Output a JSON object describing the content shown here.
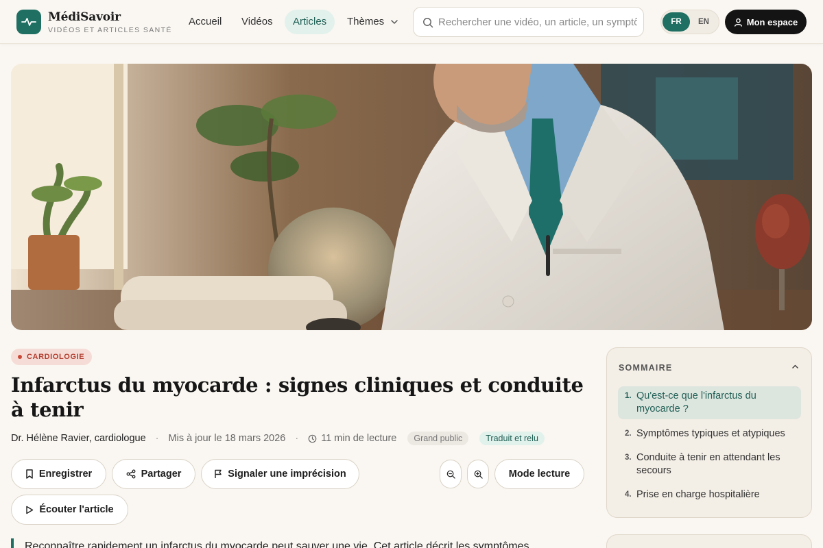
{
  "brand": {
    "name": "MédiSavoir",
    "tagline": "Vidéos et articles santé"
  },
  "nav": {
    "items": [
      {
        "label": "Accueil"
      },
      {
        "label": "Vidéos"
      },
      {
        "label": "Articles"
      },
      {
        "label": "Thèmes"
      }
    ]
  },
  "search": {
    "placeholder": "Rechercher une vidéo, un article, un symptôme…"
  },
  "lang": {
    "fr": "FR",
    "en": "EN",
    "active": "FR"
  },
  "account": {
    "label": "Mon espace"
  },
  "article": {
    "category": "CARDIOLOGIE",
    "title": "Infarctus du myocarde : signes cliniques et conduite à tenir",
    "author": "Dr. Hélène Ravier, cardiologue",
    "updated": "Mis à jour le 18 mars 2026",
    "reading_time": "11 min de lecture",
    "audience": "Grand public",
    "translation": "Traduit et relu",
    "intro": "Reconnaître rapidement un infarctus du myocarde peut sauver une vie. Cet article décrit les symptômes"
  },
  "actions": {
    "save": "Enregistrer",
    "share": "Partager",
    "report": "Signaler une imprécision",
    "reading_mode": "Mode lecture",
    "listen": "Écouter l'article"
  },
  "toc": {
    "heading": "SOMMAIRE",
    "items": [
      {
        "num": "1.",
        "label": "Qu'est-ce que l'infarctus du myocarde ?"
      },
      {
        "num": "2.",
        "label": "Symptômes typiques et atypiques"
      },
      {
        "num": "3.",
        "label": "Conduite à tenir en attendant les secours"
      },
      {
        "num": "4.",
        "label": "Prise en charge hospitalière"
      }
    ]
  },
  "colors": {
    "accent": "#1f6f62",
    "category": "#b03d2f",
    "background": "#faf7f2"
  }
}
